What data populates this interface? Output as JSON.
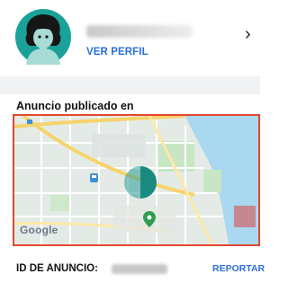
{
  "profile": {
    "link_label": "VER PERFIL",
    "chevron": "›",
    "avatar_icon": "woman-avatar-icon"
  },
  "ad_location": {
    "title": "Anuncio publicado en",
    "map_brand": "Google"
  },
  "footer": {
    "id_label": "ID DE ANUNCIO:",
    "report_label": "REPORTAR"
  },
  "colors": {
    "accent": "#2a6fd6",
    "avatar_bg": "#1aa29a",
    "map_border": "#e2472e"
  }
}
